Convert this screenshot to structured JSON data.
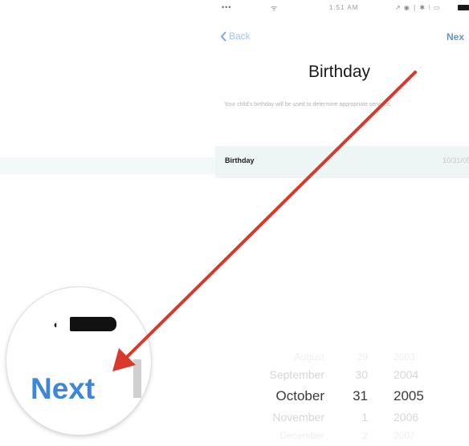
{
  "status_bar": {
    "carrier": "•••",
    "wifi": "ᯤ",
    "time": "1:51 AM",
    "right": "↗ ◉ ∣ ✱ ⁝ ▭"
  },
  "nav": {
    "back_label": "Back",
    "next_label": "Nex"
  },
  "title": "Birthday",
  "description": "Your child's birthday will be used to determine appropriate services.",
  "birthday_row": {
    "label": "Birthday",
    "value": "10/31/05"
  },
  "date_picker": {
    "rows": [
      {
        "month": "August",
        "day": "29",
        "year": "2003"
      },
      {
        "month": "September",
        "day": "30",
        "year": "2004"
      },
      {
        "month": "October",
        "day": "31",
        "year": "2005"
      },
      {
        "month": "November",
        "day": "1",
        "year": "2006"
      },
      {
        "month": "December",
        "day": "2",
        "year": "2007"
      }
    ],
    "selected": {
      "month": "October",
      "day": "31",
      "year": "2005"
    }
  },
  "magnifier": {
    "label": "Next"
  },
  "colors": {
    "accent_blue": "#3c87d8",
    "arrow_red": "#d9392b"
  }
}
